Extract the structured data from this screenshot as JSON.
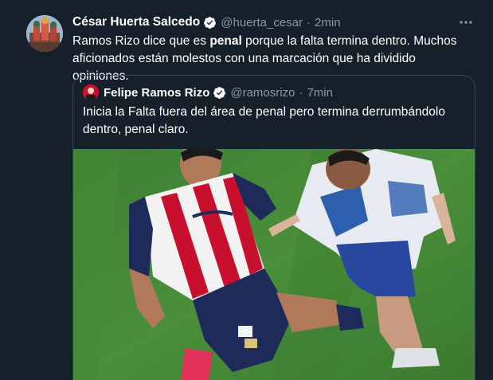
{
  "tweet": {
    "author_name": "César Huerta Salcedo",
    "handle": "@huerta_cesar",
    "separator": "·",
    "time": "2min",
    "text_part1": "Ramos Rizo dice que es ",
    "text_bold": "penal",
    "text_part2": " porque la falta termina dentro. Muchos aficionados están molestos con una marcación que ha dividido opiniones.",
    "more_icon": "more-dots-icon"
  },
  "quote": {
    "author_name": "Felipe Ramos Rizo",
    "handle": "@ramosrizo",
    "separator": "·",
    "time": "7min",
    "text": "Inicia la Falta fuera del área de penal pero termina derrumbándolo dentro, penal claro."
  },
  "colors": {
    "background": "#15202b",
    "border": "#38444d",
    "secondary_text": "#8899a6",
    "verified": "#ffffff"
  }
}
